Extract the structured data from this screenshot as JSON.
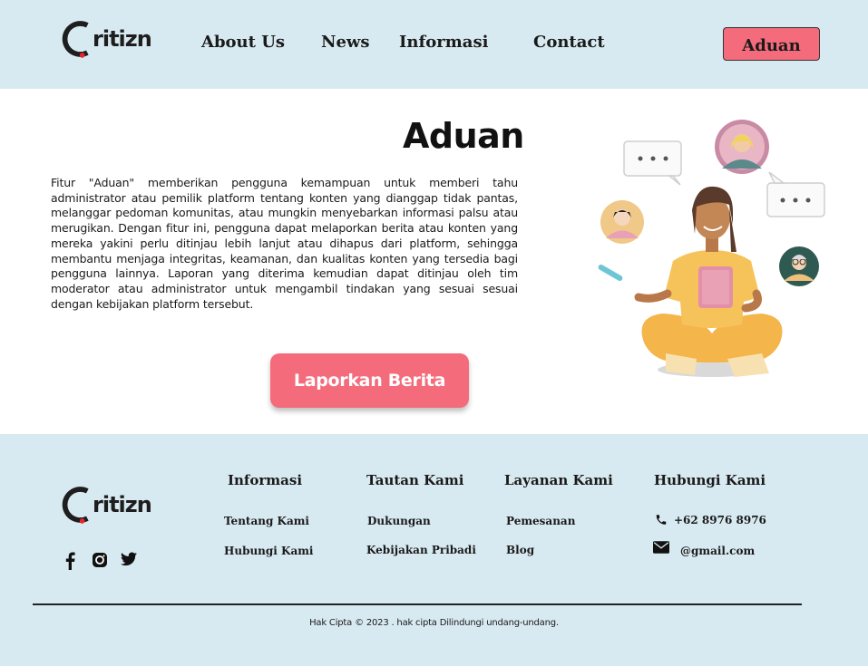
{
  "header": {
    "logo_text": "ritizn",
    "nav": {
      "about": "About Us",
      "news": "News",
      "informasi": "Informasi",
      "contact": "Contact"
    },
    "cta_label": "Aduan"
  },
  "main": {
    "title": "Aduan",
    "description": "Fitur \"Aduan\" memberikan pengguna kemampuan untuk memberi tahu administrator atau pemilik platform tentang konten yang dianggap tidak pantas, melanggar pedoman komunitas, atau mungkin menyebarkan informasi palsu atau merugikan. Dengan fitur ini, pengguna dapat melaporkan berita atau konten yang mereka yakini perlu ditinjau lebih lanjut atau dihapus dari platform, sehingga membantu menjaga integritas, keamanan, dan kualitas konten yang tersedia bagi pengguna lainnya. Laporan yang diterima kemudian dapat ditinjau oleh tim moderator atau administrator untuk mengambil tindakan yang sesuai sesuai dengan kebijakan platform tersebut.",
    "report_button": "Laporkan Berita"
  },
  "footer": {
    "logo_text": "ritizn",
    "columns": {
      "informasi": {
        "title": "Informasi",
        "links": [
          "Tentang Kami",
          "Hubungi Kami"
        ]
      },
      "tautan": {
        "title": "Tautan Kami",
        "links": [
          "Dukungan",
          "Kebijakan Pribadi"
        ]
      },
      "layanan": {
        "title": "Layanan Kami",
        "links": [
          "Pemesanan",
          "Blog"
        ]
      },
      "hubungi": {
        "title": "Hubungi Kami",
        "phone": "+62 8976 8976",
        "email": "@gmail.com"
      }
    },
    "social_icons": [
      "facebook-icon",
      "instagram-icon",
      "twitter-icon"
    ],
    "copyright": "Hak Cipta © 2023 . hak cipta Dilindungi undang-undang."
  },
  "colors": {
    "band": "#d8eaf1",
    "accent": "#f46b7b",
    "logo_dot": "#e8252e",
    "logo_spark": "#f2c230"
  }
}
